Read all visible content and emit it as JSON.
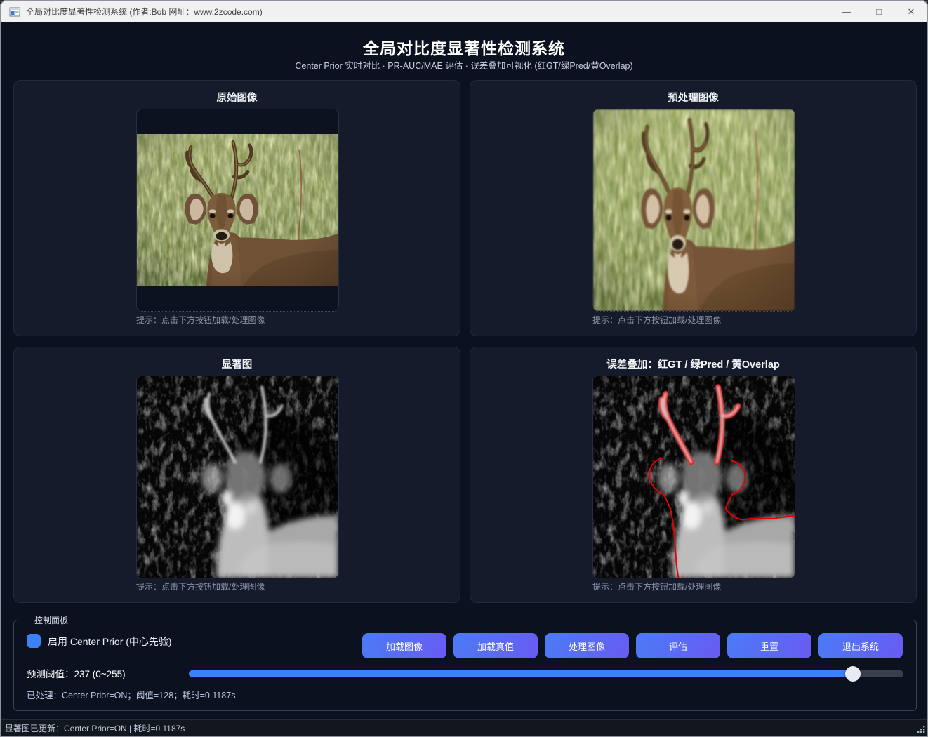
{
  "window": {
    "title": "全局对比度显著性检测系统 (作者:Bob 网址：www.2zcode.com)",
    "controls": {
      "minimize": "—",
      "maximize": "□",
      "close": "✕"
    }
  },
  "header": {
    "title": "全局对比度显著性检测系统",
    "subtitle": "Center Prior 实时对比 · PR-AUC/MAE 评估 · 误差叠加可视化 (红GT/绿Pred/黄Overlap)"
  },
  "panels": [
    {
      "title": "原始图像",
      "hint": "提示：点击下方按钮加载/处理图像"
    },
    {
      "title": "预处理图像",
      "hint": "提示：点击下方按钮加载/处理图像"
    },
    {
      "title": "显著图",
      "hint": "提示：点击下方按钮加载/处理图像"
    },
    {
      "title": "误差叠加：红GT / 绿Pred / 黄Overlap",
      "hint": "提示：点击下方按钮加载/处理图像"
    }
  ],
  "control_panel": {
    "label": "控制面板",
    "checkbox": {
      "checked": true,
      "label": "启用 Center Prior (中心先验)"
    },
    "buttons": [
      {
        "label": "加载图像"
      },
      {
        "label": "加载真值"
      },
      {
        "label": "处理图像"
      },
      {
        "label": "评估"
      },
      {
        "label": "重置"
      },
      {
        "label": "退出系统"
      }
    ],
    "slider": {
      "label": "预测阈值：237 (0~255)",
      "value": 237,
      "min": 0,
      "max": 255
    },
    "status": "已处理：Center Prior=ON；阈值=128；耗时=0.1187s"
  },
  "status_bar": {
    "text": "显著图已更新：Center Prior=ON | 耗时=0.1187s"
  },
  "colors": {
    "page-bg": "#0c1120",
    "panel-bg": "#151b2b",
    "panel-border": "#232b3e",
    "titlebar-bg": "#f1f1f1",
    "accent": "#3b82f6",
    "btn-grad-a": "#4a7cf6",
    "btn-grad-b": "#6a5af2",
    "hint": "#8b94a8",
    "title-text": "#ffffff",
    "status-text": "#b9c6de",
    "slider-track": "#3a3f4e",
    "slider-handle": "#e8eaf4",
    "gt-red": "#e60000"
  }
}
